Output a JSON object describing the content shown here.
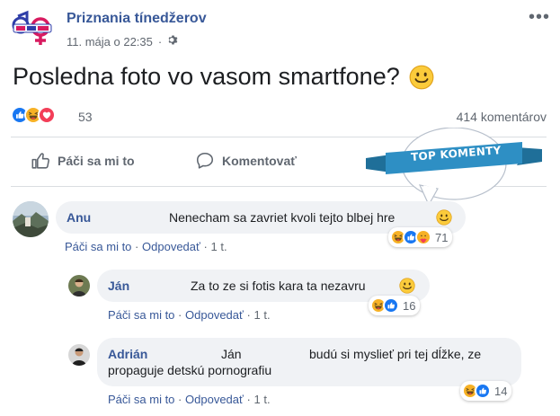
{
  "post": {
    "page_name": "Priznania tínedžerov",
    "timestamp": "11. mája o 22:35",
    "text": "Posledna foto vo vasom smartfone?",
    "reaction_count": "53",
    "comments_count": "414 komentárov"
  },
  "actions": {
    "like_label": "Páči sa mi to",
    "comment_label": "Komentovať"
  },
  "badge": {
    "label": "TOP KOMENTY"
  },
  "comments": [
    {
      "author": "Anu",
      "text": "Nenecham sa zavriet kvoli tejto blbej hre",
      "like_label": "Páči sa mi to",
      "reply_label": "Odpovedať",
      "time": "1 t.",
      "reaction_count": "71"
    },
    {
      "author": "Ján",
      "text": "Za to ze si fotis kara ta nezavru",
      "like_label": "Páči sa mi to",
      "reply_label": "Odpovedať",
      "time": "1 t.",
      "reaction_count": "16"
    },
    {
      "author": "Adrián",
      "mention": "Ján",
      "text_line1": "budú si myslieť pri tej dĺžke, ze",
      "text_line2": "propaguje detskú pornografiu",
      "like_label": "Páči sa mi to",
      "reply_label": "Odpovedať",
      "time": "1 t.",
      "reaction_count": "14"
    }
  ],
  "separator": "·",
  "colors": {
    "link": "#385898",
    "muted": "#606770",
    "bubble": "#f0f2f5",
    "badge": "#2e8fc4",
    "like": "#1877f2",
    "love": "#f33e58",
    "haha": "#f7b125"
  },
  "icons": [
    "page-logo-icon",
    "gear-icon",
    "more-icon",
    "like-icon",
    "comment-icon",
    "haha-icon",
    "love-icon",
    "care-icon",
    "smile-emoji-icon"
  ]
}
